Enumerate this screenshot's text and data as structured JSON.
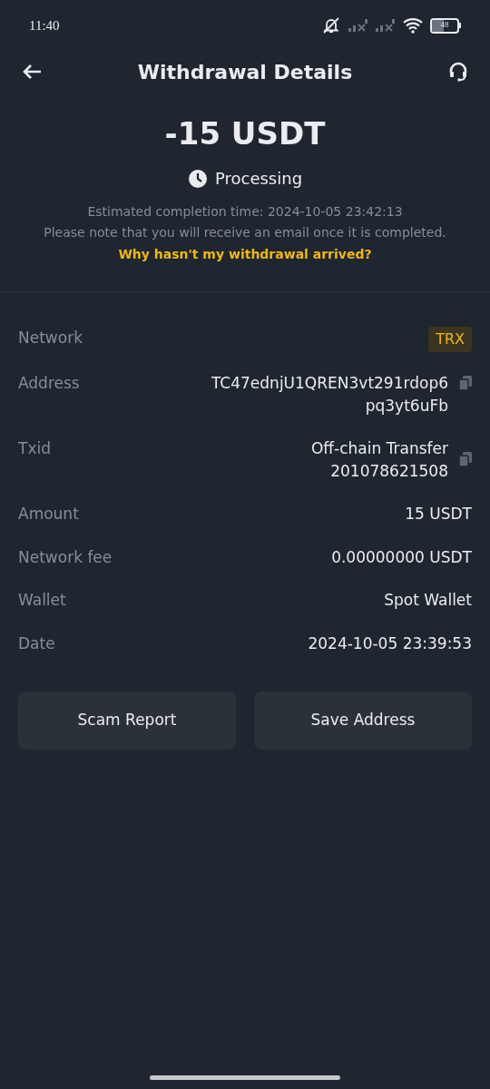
{
  "status_bar": {
    "time": "11:40",
    "battery": "48"
  },
  "header": {
    "title": "Withdrawal Details"
  },
  "summary": {
    "amount": "-15 USDT",
    "status": "Processing",
    "notes": [
      "Estimated completion time: 2024-10-05 23:42:13",
      "Please note that you will receive an email once it is completed."
    ],
    "link": "Why hasn't my withdrawal arrived?"
  },
  "details": [
    {
      "kind": "badge",
      "label": "Network",
      "lines": [
        "TRX"
      ]
    },
    {
      "kind": "copy",
      "label": "Address",
      "lines": [
        "TC47ednjU1QREN3vt291rdop6",
        "pq3yt6uFb"
      ]
    },
    {
      "kind": "copy",
      "label": "Txid",
      "lines": [
        "Off-chain Transfer",
        "201078621508"
      ]
    },
    {
      "kind": "text",
      "label": "Amount",
      "lines": [
        "15 USDT"
      ]
    },
    {
      "kind": "text",
      "label": "Network fee",
      "lines": [
        "0.00000000 USDT"
      ]
    },
    {
      "kind": "text",
      "label": "Wallet",
      "lines": [
        "Spot Wallet"
      ]
    },
    {
      "kind": "text",
      "label": "Date",
      "lines": [
        "2024-10-05 23:39:53"
      ]
    }
  ],
  "buttons": [
    "Scam Report",
    "Save Address"
  ]
}
